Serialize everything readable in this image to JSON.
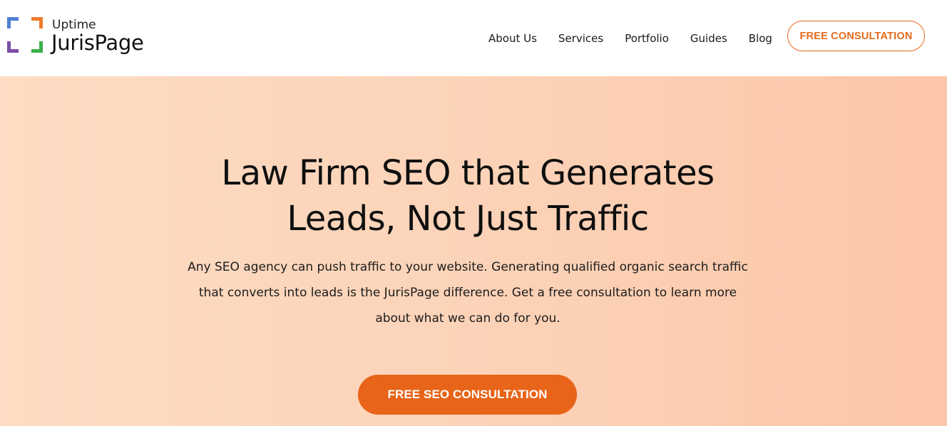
{
  "brand": {
    "small": "Uptime",
    "name": "JurisPage",
    "mark_colors": [
      "#4f7fd6",
      "#f07b2a",
      "#7b4ea8",
      "#3ab04a"
    ]
  },
  "nav": {
    "items": [
      {
        "label": "About Us"
      },
      {
        "label": "Services"
      },
      {
        "label": "Portfolio"
      },
      {
        "label": "Guides"
      },
      {
        "label": "Blog"
      }
    ],
    "cta_label": "FREE CONSULTATION"
  },
  "hero": {
    "title_line1": "Law Firm SEO that Generates",
    "title_line2": "Leads, Not Just Traffic",
    "body_line1": "Any SEO agency can push traffic to your website. Generating qualified organic search traffic",
    "body_line2": "that converts into leads is the JurisPage difference. Get a free consultation to learn more",
    "body_line3": "about what we can do for you.",
    "cta_label": "FREE SEO CONSULTATION"
  },
  "colors": {
    "accent": "#e86418",
    "hero_bg_left": "#fddcc3",
    "hero_bg_right": "#fcc6a8"
  }
}
